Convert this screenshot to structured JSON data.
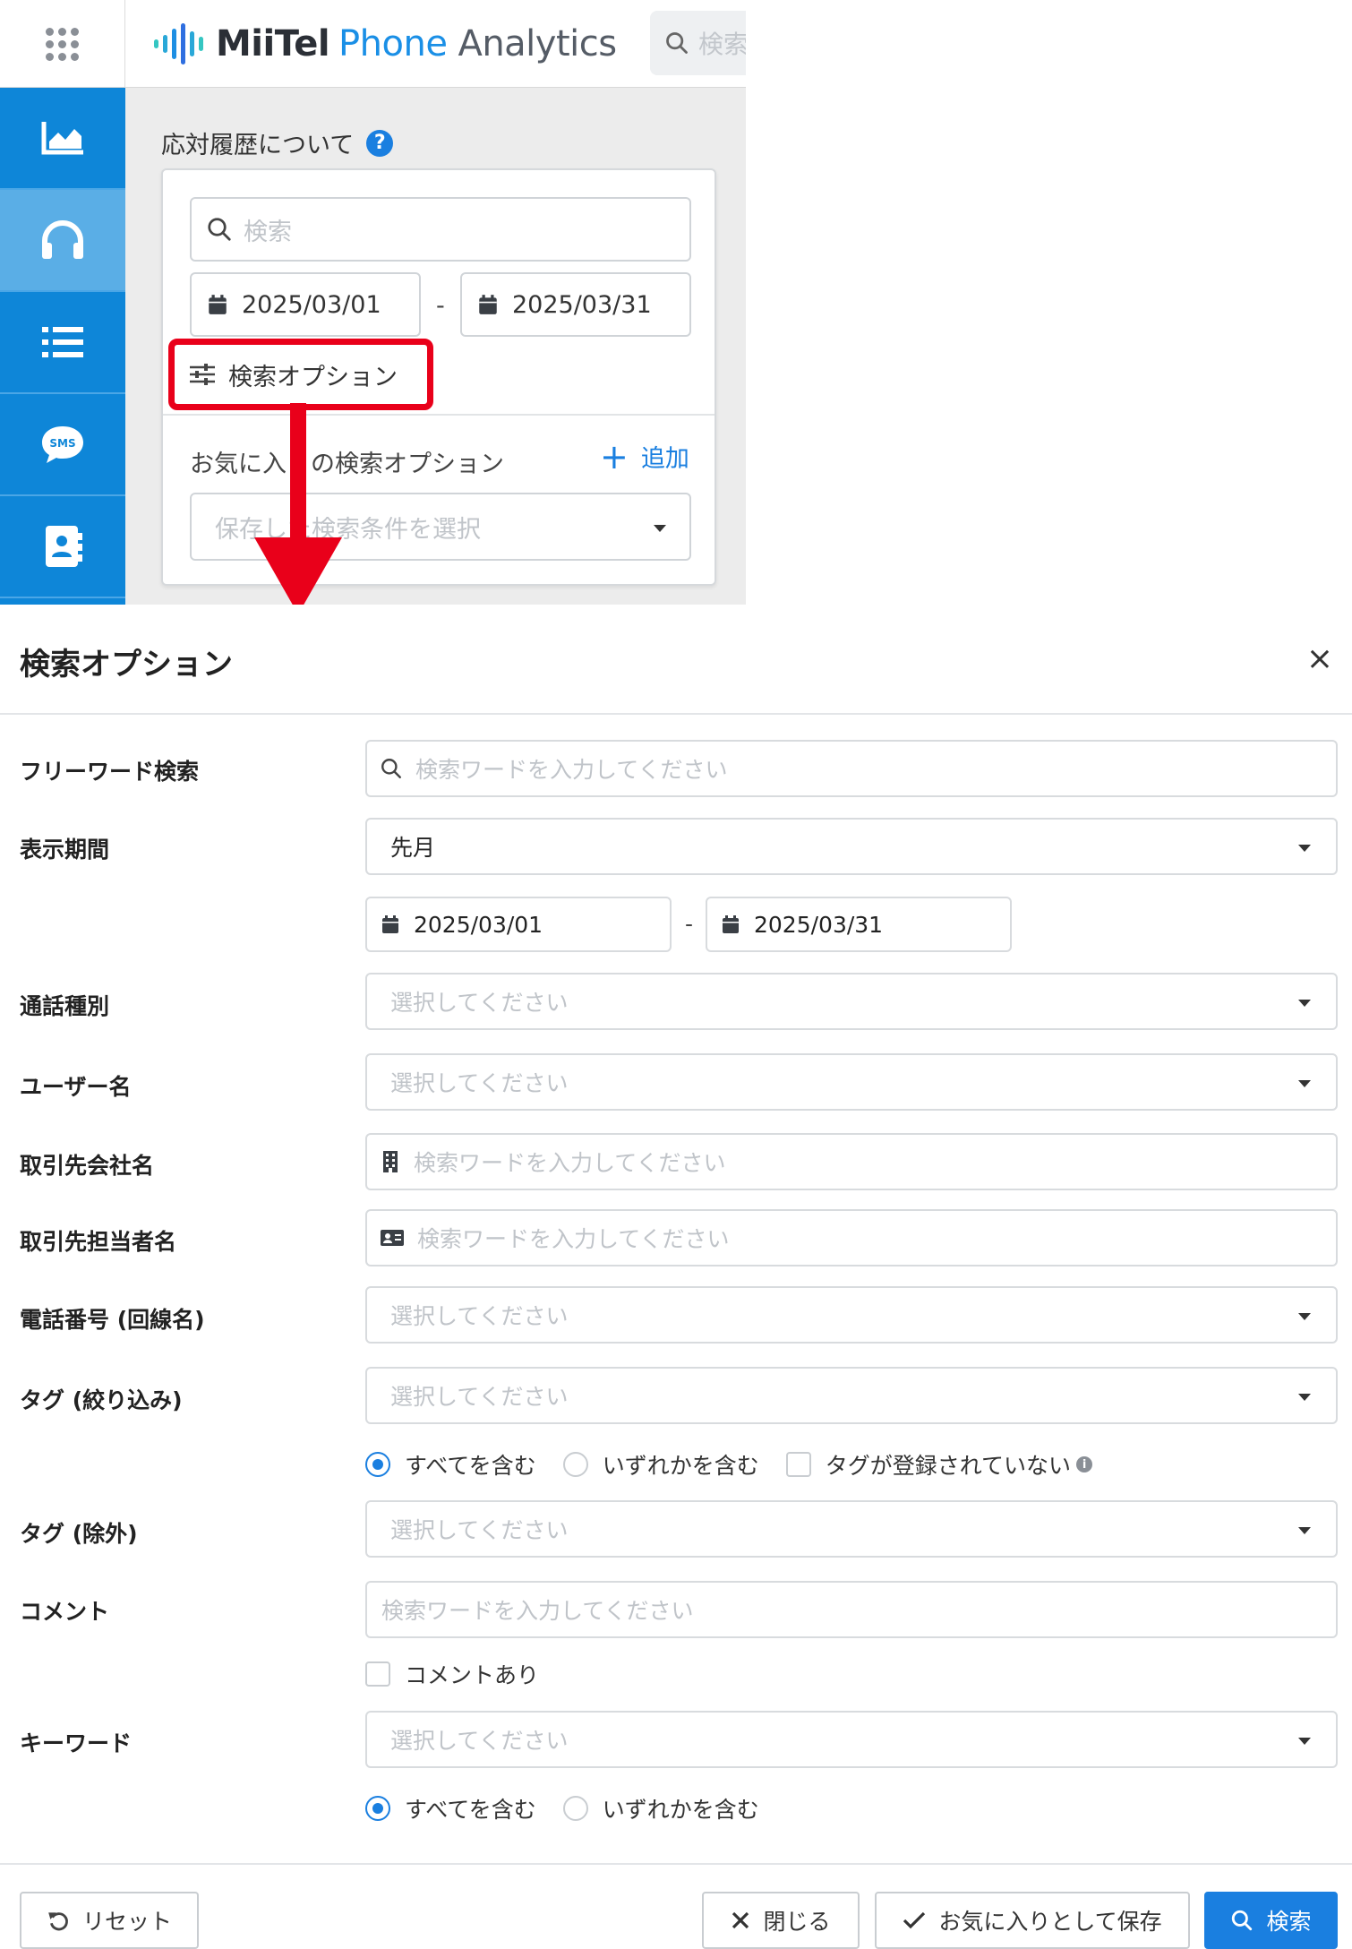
{
  "header": {
    "brand_miitel": "MiiTel",
    "brand_phone": "Phone",
    "brand_analytics": "Analytics",
    "search_placeholder": "検索"
  },
  "sidebar": {
    "items": [
      {
        "icon": "chart-area-icon"
      },
      {
        "icon": "headset-icon",
        "active": true
      },
      {
        "icon": "list-icon"
      },
      {
        "icon": "sms-icon",
        "badge": "SMS"
      },
      {
        "icon": "contact-book-icon"
      }
    ]
  },
  "panel": {
    "title": "応対履歴について",
    "help": "?",
    "search_placeholder": "検索",
    "date_from": "2025/03/01",
    "date_separator": "-",
    "date_to": "2025/03/31",
    "options_button": "検索オプション",
    "favorites_label": "お気に入りの検索オプション",
    "favorites_add": "追加",
    "favorites_select_placeholder": "保存した検索条件を選択"
  },
  "modal": {
    "title": "検索オプション",
    "close": "×",
    "fields": {
      "freeword": {
        "label": "フリーワード検索",
        "placeholder": "検索ワードを入力してください"
      },
      "period": {
        "label": "表示期間",
        "value": "先月",
        "date_from": "2025/03/01",
        "date_separator": "-",
        "date_to": "2025/03/31"
      },
      "call_type": {
        "label": "通話種別",
        "placeholder": "選択してください"
      },
      "user_name": {
        "label": "ユーザー名",
        "placeholder": "選択してください"
      },
      "company": {
        "label": "取引先会社名",
        "placeholder": "検索ワードを入力してください"
      },
      "contact": {
        "label": "取引先担当者名",
        "placeholder": "検索ワードを入力してください"
      },
      "phone": {
        "label": "電話番号 (回線名)",
        "placeholder": "選択してください"
      },
      "tag_filter": {
        "label": "タグ (絞り込み)",
        "placeholder": "選択してください",
        "opt_all": "すべてを含む",
        "opt_any": "いずれかを含む",
        "opt_none": "タグが登録されていない",
        "info": "i"
      },
      "tag_exclude": {
        "label": "タグ (除外)",
        "placeholder": "選択してください"
      },
      "comment": {
        "label": "コメント",
        "placeholder": "検索ワードを入力してください",
        "has_comment": "コメントあり"
      },
      "keyword": {
        "label": "キーワード",
        "placeholder": "選択してください",
        "opt_all": "すべてを含む",
        "opt_any": "いずれかを含む"
      }
    },
    "footer": {
      "reset": "リセット",
      "close": "閉じる",
      "save_favorite": "お気に入りとして保存",
      "search": "検索"
    }
  },
  "colors": {
    "accent": "#1a7fe0",
    "sidebar": "#0e86d8",
    "highlight": "#e9001a"
  }
}
